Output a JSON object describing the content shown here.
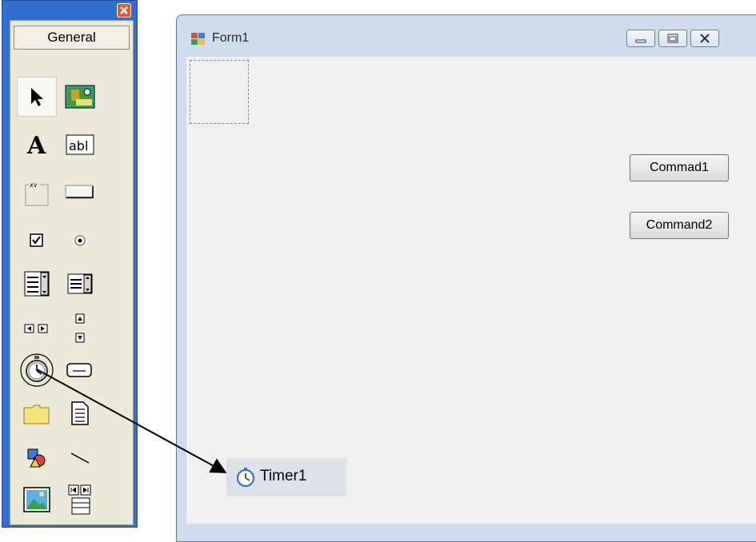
{
  "toolbox": {
    "tab_label": "General",
    "tools": [
      {
        "name": "pointer-icon"
      },
      {
        "name": "picturebox-icon"
      },
      {
        "name": "label-icon",
        "glyph": "A"
      },
      {
        "name": "textbox-icon",
        "glyph": "abl"
      },
      {
        "name": "frame-icon",
        "glyph": "xv"
      },
      {
        "name": "commandbutton-icon"
      },
      {
        "name": "checkbox-icon"
      },
      {
        "name": "optionbutton-icon"
      },
      {
        "name": "combobox-icon"
      },
      {
        "name": "listbox-icon"
      },
      {
        "name": "hscrollbar-icon"
      },
      {
        "name": "vscrollbar-icon"
      },
      {
        "name": "timer-icon"
      },
      {
        "name": "drivelistbox-icon"
      },
      {
        "name": "dirlistbox-icon"
      },
      {
        "name": "filelistbox-icon"
      },
      {
        "name": "shape-icon"
      },
      {
        "name": "line-icon"
      },
      {
        "name": "image-icon"
      },
      {
        "name": "data-icon"
      }
    ]
  },
  "form": {
    "title": "Form1",
    "buttons": {
      "command1": "Commad1",
      "command2": "Command2"
    },
    "timer_label": "Timer1"
  },
  "colors": {
    "toolbox_frame": "#2f6fd0",
    "toolbox_bg": "#ece9d8",
    "form_client": "#f0f0f0",
    "form_frame": "#cfdcec"
  }
}
